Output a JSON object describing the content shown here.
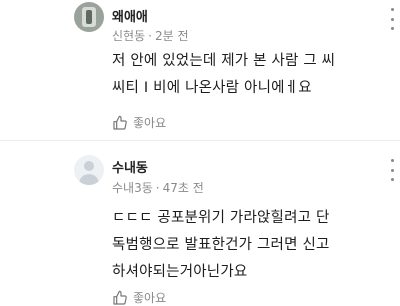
{
  "comments": [
    {
      "author": "왜애애",
      "location": "신현동",
      "time": "2분 전",
      "text": "저 안에 있었는데 제가 본 사람 그 씨\n씨티 I 비에 나온사람 아니에ㅔ요",
      "like_label": "좋아요"
    },
    {
      "author": "수내동",
      "location": "수내3동",
      "time": "47초 전",
      "text": "ㄷㄷㄷ 공포분위기 가라앉힐려고 단\n독범행으로 발표한건가 그러면 신고\n하셔야되는거아닌가요",
      "like_label": "좋아요"
    }
  ],
  "icons": {
    "like": "thumbs-up-icon",
    "more": "more-vertical-icon"
  }
}
